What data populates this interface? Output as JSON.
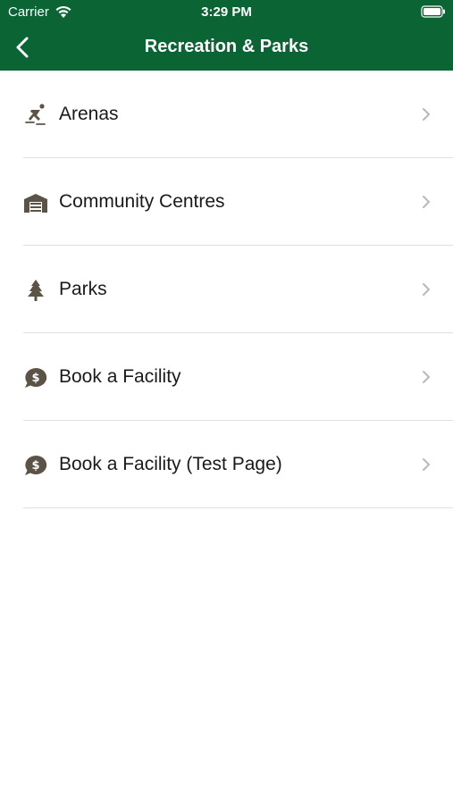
{
  "status_bar": {
    "carrier": "Carrier",
    "time": "3:29 PM"
  },
  "nav": {
    "title": "Recreation & Parks"
  },
  "colors": {
    "header_bg": "#0a6433",
    "icon": "#5b5346",
    "chevron": "#b8b8b8"
  },
  "items": [
    {
      "label": "Arenas",
      "icon": "skater-icon"
    },
    {
      "label": "Community Centres",
      "icon": "building-icon"
    },
    {
      "label": "Parks",
      "icon": "pine-tree-icon"
    },
    {
      "label": "Book a Facility",
      "icon": "money-chat-icon"
    },
    {
      "label": "Book a Facility (Test Page)",
      "icon": "money-chat-icon"
    }
  ]
}
